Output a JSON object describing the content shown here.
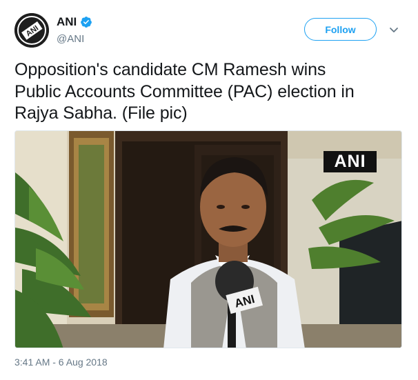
{
  "account": {
    "display_name": "ANI",
    "handle": "@ANI",
    "avatar_icon": "ani-logo-avatar",
    "verified_icon": "verified-badge-icon",
    "avatar_text": "ANI"
  },
  "actions": {
    "follow_label": "Follow",
    "more_icon": "chevron-down-icon"
  },
  "tweet": {
    "text_lines": [
      "Opposition's candidate CM Ramesh wins",
      "Public Accounts Committee (PAC) election in",
      "Rajya Sabha. (File pic)"
    ],
    "media": {
      "watermark": "ANI",
      "mic_label": "ANI"
    },
    "timestamp": "3:41 AM - 6 Aug 2018"
  },
  "colors": {
    "accent": "#1da1f2",
    "secondary_text": "#657786",
    "primary_text": "#14171a"
  }
}
